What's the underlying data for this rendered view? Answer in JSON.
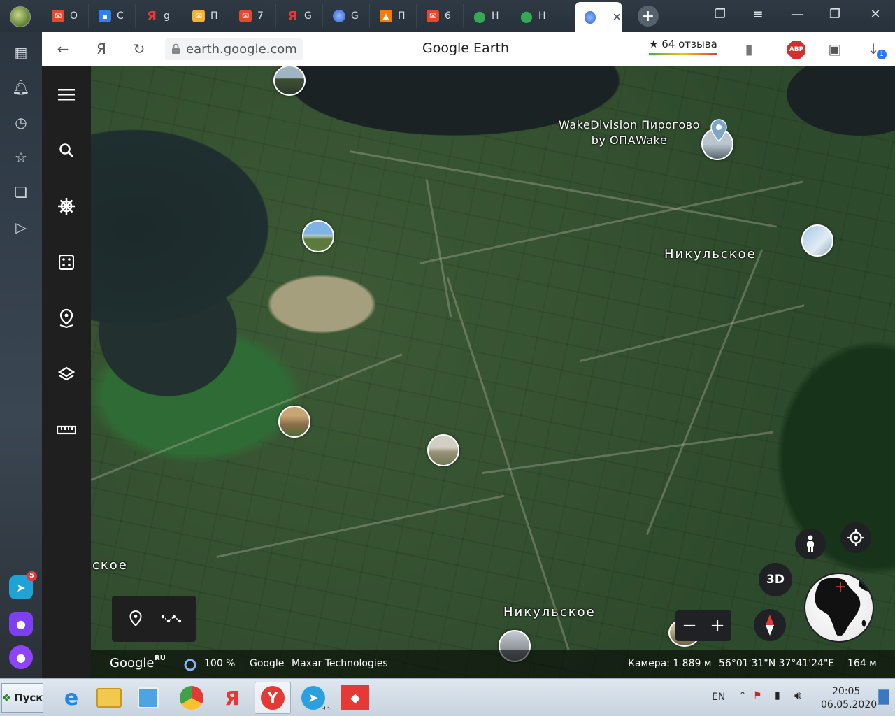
{
  "browser": {
    "tabs": [
      {
        "label": "О",
        "icon": "mail-ru-icon",
        "color": "#e5482f"
      },
      {
        "label": "С",
        "icon": "chat-icon",
        "color": "#2f80ed"
      },
      {
        "label": "g",
        "icon": "yandex-icon",
        "color": "#e53935"
      },
      {
        "label": "П",
        "icon": "mail-icon",
        "color": "#f2b233"
      },
      {
        "label": "7",
        "icon": "mail-ru-icon",
        "color": "#e5482f"
      },
      {
        "label": "G",
        "icon": "yandex-icon",
        "color": "#e53935"
      },
      {
        "label": "G",
        "icon": "google-earth-icon",
        "color": "#4a8af4"
      },
      {
        "label": "П",
        "icon": "fire-icon",
        "color": "#f57c00"
      },
      {
        "label": "6",
        "icon": "mail-ru-icon",
        "color": "#e5482f"
      },
      {
        "label": "Н",
        "icon": "maps-icon",
        "color": "#34a853"
      },
      {
        "label": "Н",
        "icon": "maps-icon",
        "color": "#34a853"
      }
    ],
    "address": "earth.google.com",
    "page_title": "Google Earth",
    "reviews": "★ 64 отзыва",
    "abp": "ABP",
    "downloads_count": "1",
    "sidebar_badge": "5"
  },
  "map": {
    "labels": {
      "wake": "WakeDivision Пирогово by ОПАWake",
      "place_main": "Никульское",
      "place_bottom": "Никульское",
      "place_left": "ское"
    },
    "btn_3d": "3D"
  },
  "statusbar": {
    "logo": "Google",
    "logo_suffix": "RU",
    "progress": "100 %",
    "credit_google": "Google",
    "credit_maxar": "Maxar Technologies",
    "camera": "Камера: 1 889 м",
    "coords": "56°01'31\"N 37°41'24\"E",
    "scale": "164 м"
  },
  "taskbar": {
    "start": "Пуск",
    "lang": "EN",
    "time": "20:05",
    "date": "06.05.2020",
    "telegram_badge": "93"
  }
}
